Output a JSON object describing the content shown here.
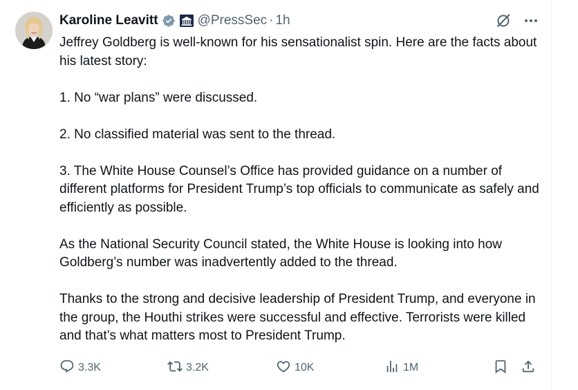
{
  "tweet": {
    "author": {
      "display_name": "Karoline Leavitt",
      "verified_badge": "verified-gray-check-icon",
      "affiliation_icon": "white-house-icon",
      "handle": "@PressSec",
      "separator": "·",
      "time": "1h"
    },
    "paragraphs": [
      "Jeffrey Goldberg is well-known for his sensationalist spin. Here are the facts about his latest story:",
      "1. No “war plans” were discussed.",
      "2. No classified material was sent to the thread.",
      "3. The White House Counsel’s Office has provided guidance on a number of different platforms for President Trump’s top officials to communicate as safely and efficiently as possible.",
      "As the National Security Council stated, the White House is looking into how Goldberg’s number was inadvertently added to the thread.",
      "Thanks to the strong and decisive leadership of President Trump, and everyone in the group, the Houthi strikes were successful and effective. Terrorists were killed and that’s what matters most to President Trump."
    ],
    "metrics": {
      "replies": "3.3K",
      "reposts": "3.2K",
      "likes": "10K",
      "views": "1M"
    }
  },
  "icons": {
    "top_right": [
      "grok-icon",
      "more-icon"
    ],
    "actions": [
      "reply-icon",
      "repost-icon",
      "like-icon",
      "views-icon",
      "bookmark-icon",
      "share-icon"
    ]
  },
  "colors": {
    "text_primary": "#0f1419",
    "text_secondary": "#536471",
    "verified_gray": "#829aab",
    "divider": "#eff3f4"
  }
}
